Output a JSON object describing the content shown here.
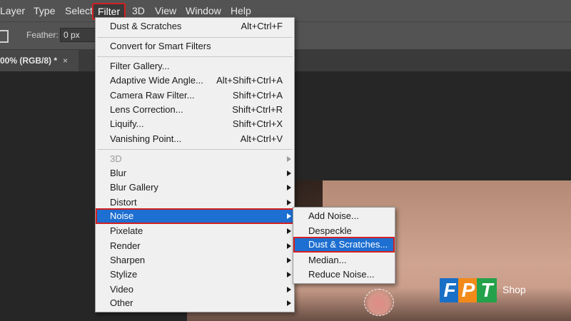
{
  "menubar": {
    "items": [
      "Layer",
      "Type",
      "Select",
      "Filter",
      "3D",
      "View",
      "Window",
      "Help"
    ]
  },
  "options": {
    "feather_label": "Feather:",
    "feather_value": "0 px"
  },
  "document_tab": {
    "title": "00% (RGB/8) *",
    "close": "×"
  },
  "filter_menu": {
    "groups": [
      [
        {
          "label": "Dust & Scratches",
          "shortcut": "Alt+Ctrl+F"
        }
      ],
      [
        {
          "label": "Convert for Smart Filters",
          "shortcut": ""
        }
      ],
      [
        {
          "label": "Filter Gallery...",
          "shortcut": ""
        },
        {
          "label": "Adaptive Wide Angle...",
          "shortcut": "Alt+Shift+Ctrl+A"
        },
        {
          "label": "Camera Raw Filter...",
          "shortcut": "Shift+Ctrl+A"
        },
        {
          "label": "Lens Correction...",
          "shortcut": "Shift+Ctrl+R"
        },
        {
          "label": "Liquify...",
          "shortcut": "Shift+Ctrl+X"
        },
        {
          "label": "Vanishing Point...",
          "shortcut": "Alt+Ctrl+V"
        }
      ],
      [
        {
          "label": "3D",
          "submenu": true,
          "disabled": true
        },
        {
          "label": "Blur",
          "submenu": true
        },
        {
          "label": "Blur Gallery",
          "submenu": true
        },
        {
          "label": "Distort",
          "submenu": true
        },
        {
          "label": "Noise",
          "submenu": true,
          "selected": true
        },
        {
          "label": "Pixelate",
          "submenu": true
        },
        {
          "label": "Render",
          "submenu": true
        },
        {
          "label": "Sharpen",
          "submenu": true
        },
        {
          "label": "Stylize",
          "submenu": true
        },
        {
          "label": "Video",
          "submenu": true
        },
        {
          "label": "Other",
          "submenu": true
        }
      ]
    ]
  },
  "noise_submenu": {
    "items": [
      {
        "label": "Add Noise..."
      },
      {
        "label": "Despeckle"
      },
      {
        "label": "Dust & Scratches...",
        "selected": true
      },
      {
        "label": "Median..."
      },
      {
        "label": "Reduce Noise..."
      }
    ]
  },
  "watermark": {
    "letters": [
      "F",
      "P",
      "T"
    ],
    "suffix": "Shop",
    "colors": [
      "#1a6fc6",
      "#f28a1a",
      "#24a14a"
    ]
  },
  "colors": {
    "menu_highlight": "#1d6fd1",
    "callout_outline": "#d42020",
    "menubar_bg": "#535353",
    "menu_bg": "#f0f0f0"
  },
  "active_menu": "Filter",
  "selected_filter_category": "Noise",
  "selected_filter": "Dust & Scratches..."
}
